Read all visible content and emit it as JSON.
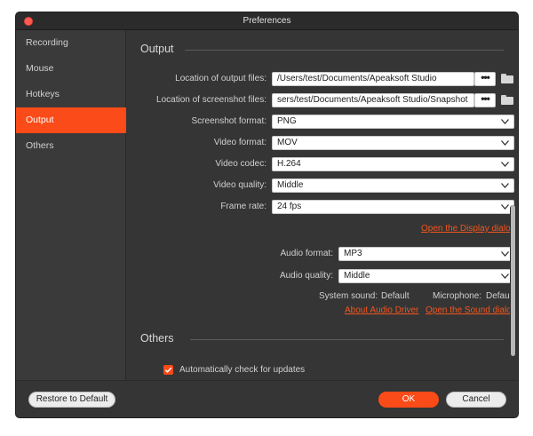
{
  "window": {
    "title": "Preferences"
  },
  "sidebar": {
    "items": [
      {
        "label": "Recording"
      },
      {
        "label": "Mouse"
      },
      {
        "label": "Hotkeys"
      },
      {
        "label": "Output"
      },
      {
        "label": "Others"
      }
    ],
    "active": "Output"
  },
  "output": {
    "section_title": "Output",
    "location_output": {
      "label": "Location of output files:",
      "value": "/Users/test/Documents/Apeaksoft Studio"
    },
    "location_screenshot": {
      "label": "Location of screenshot files:",
      "value": "sers/test/Documents/Apeaksoft Studio/Snapshot"
    },
    "browse_label": "•••",
    "screenshot_format": {
      "label": "Screenshot format:",
      "value": "PNG"
    },
    "video_format": {
      "label": "Video format:",
      "value": "MOV"
    },
    "video_codec": {
      "label": "Video codec:",
      "value": "H.264"
    },
    "video_quality": {
      "label": "Video quality:",
      "value": "Middle"
    },
    "frame_rate": {
      "label": "Frame rate:",
      "value": "24 fps"
    },
    "display_dialog_link": "Open the Display dialog",
    "audio_format": {
      "label": "Audio format:",
      "value": "MP3"
    },
    "audio_quality": {
      "label": "Audio quality:",
      "value": "Middle"
    },
    "system_sound": {
      "label": "System sound:",
      "value": "Default"
    },
    "microphone": {
      "label": "Microphone:",
      "value": "Default"
    },
    "audio_driver_link": "About Audio Driver",
    "sound_dialog_link": "Open the Sound dialog"
  },
  "others": {
    "section_title": "Others",
    "auto_update": {
      "label": "Automatically check for updates",
      "checked": true
    }
  },
  "footer": {
    "restore_label": "Restore to Default",
    "ok_label": "OK",
    "cancel_label": "Cancel"
  },
  "colors": {
    "accent": "#fa4b18",
    "link": "#f2551e",
    "bg": "#353535",
    "sidebar_bg": "#3a3a3a"
  }
}
